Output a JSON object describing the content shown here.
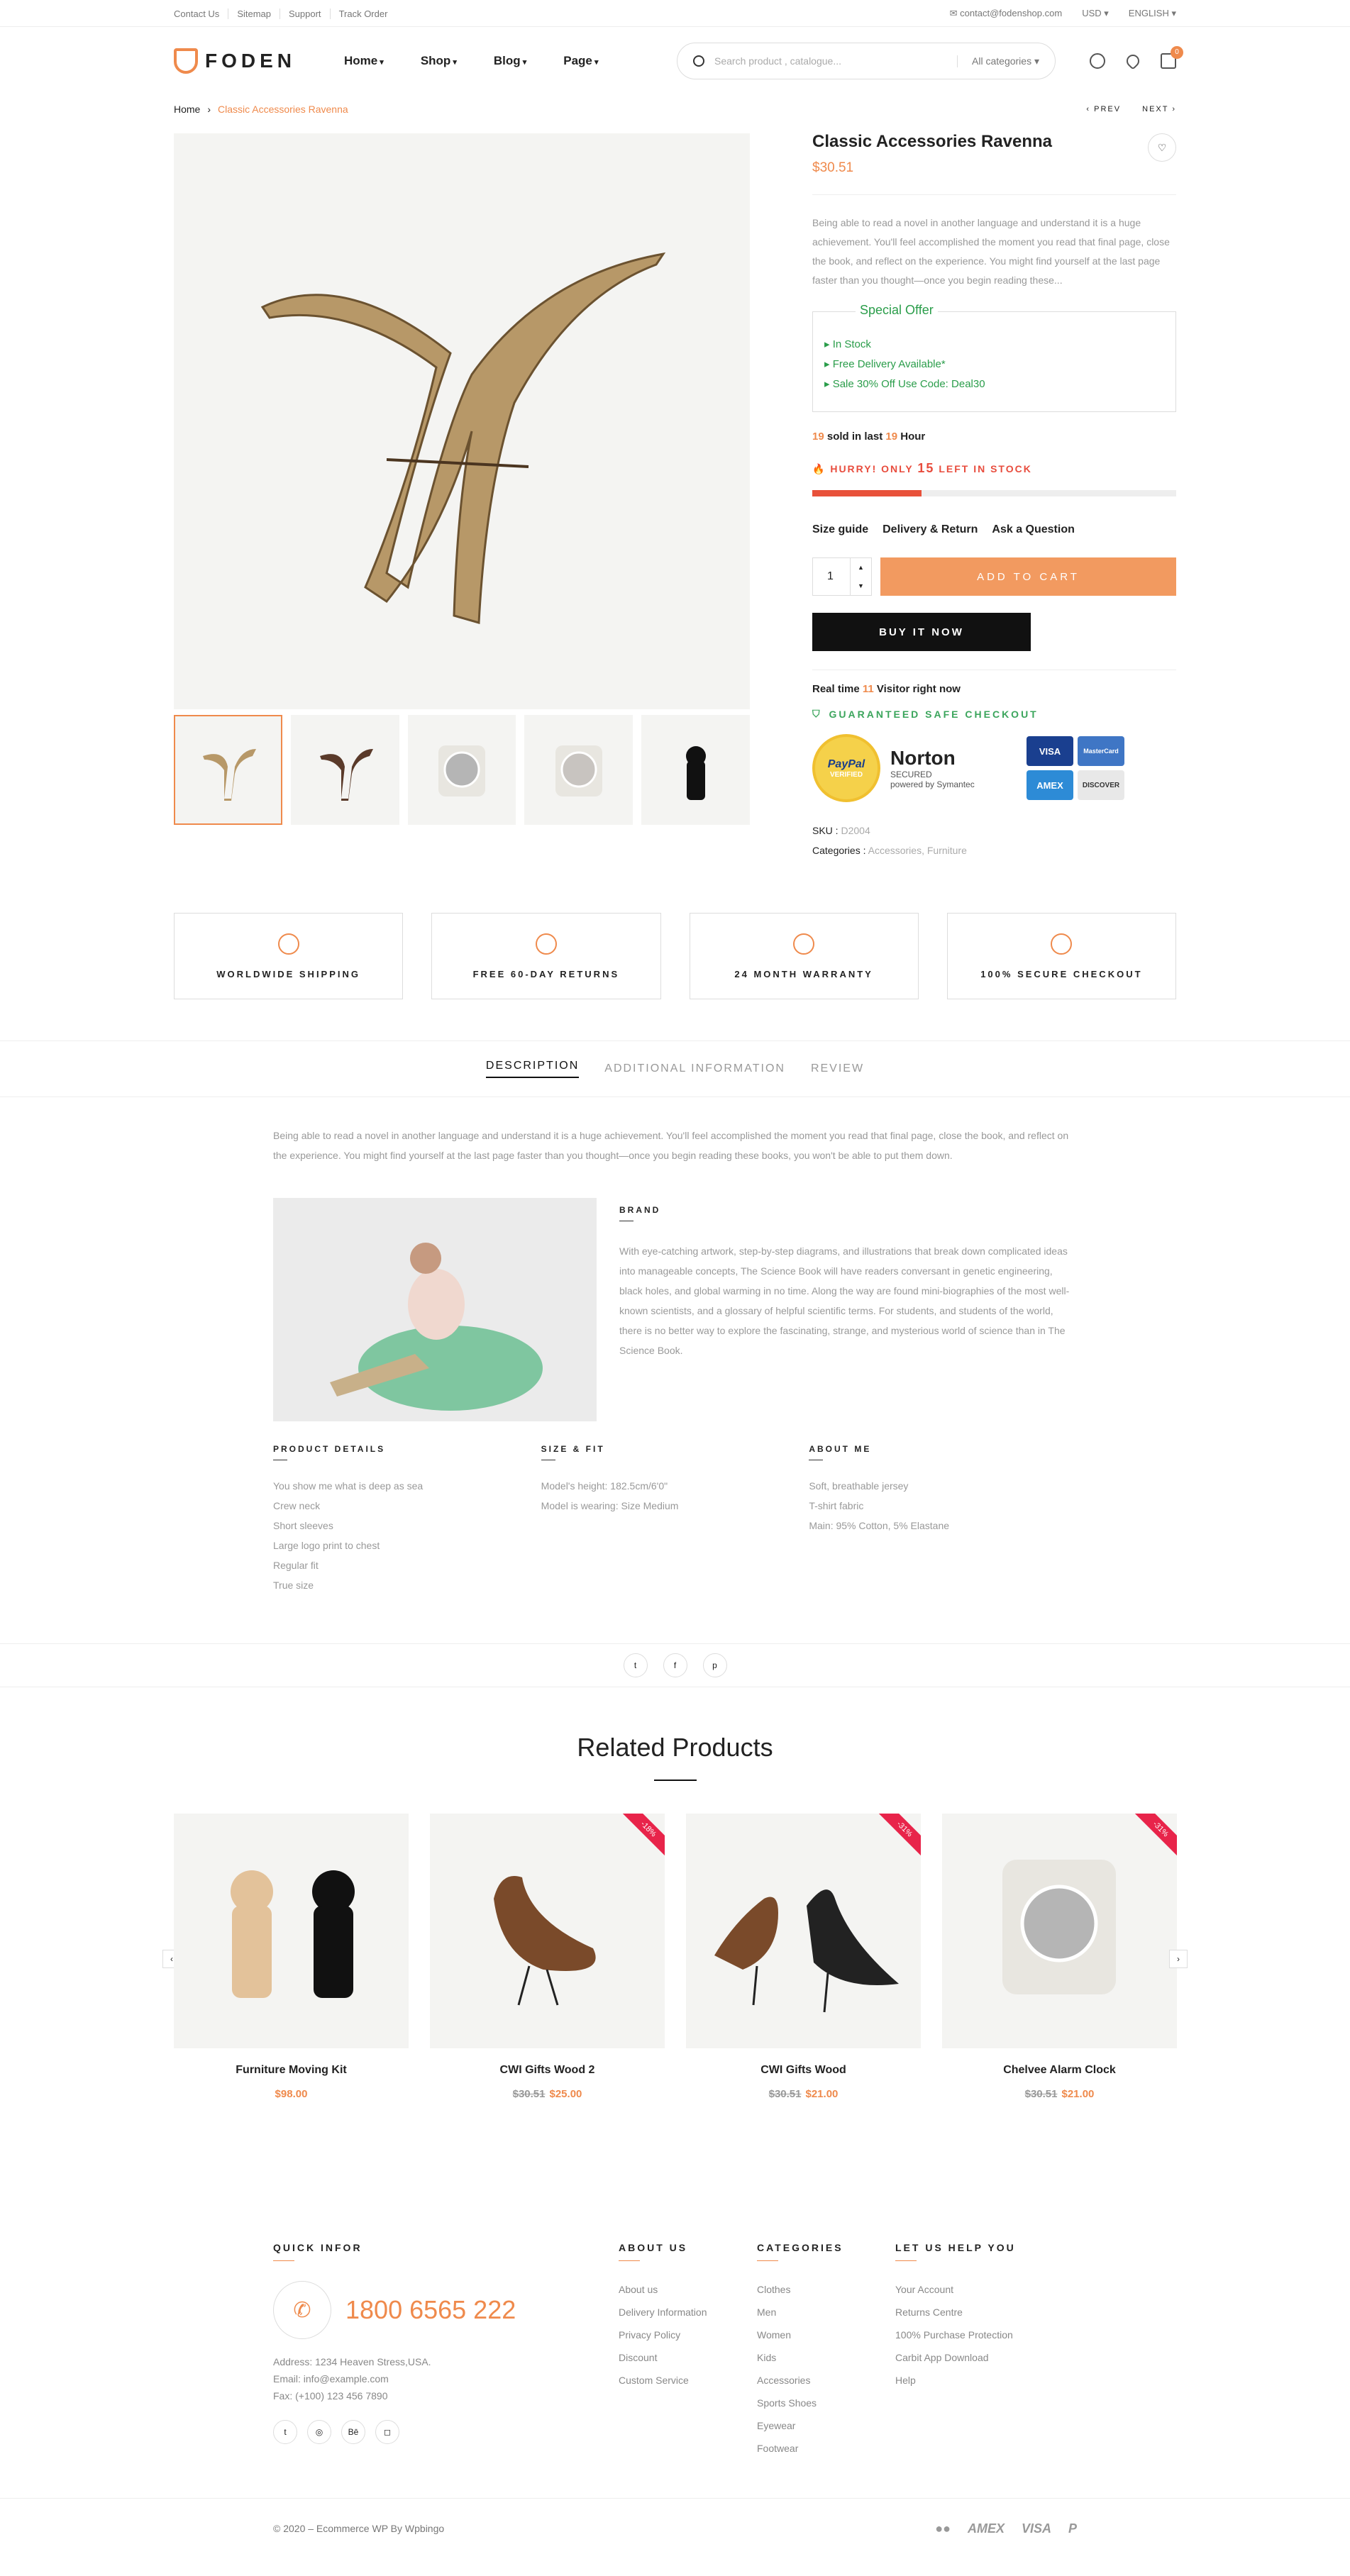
{
  "topbar": {
    "links": [
      "Contact Us",
      "Sitemap",
      "Support",
      "Track Order"
    ],
    "email": "contact@fodenshop.com",
    "currency": "USD",
    "language": "ENGLISH"
  },
  "header": {
    "logo": "FODEN",
    "nav": [
      "Home",
      "Shop",
      "Blog",
      "Page"
    ],
    "search_placeholder": "Search product , catalogue...",
    "category": "All categories",
    "cart_count": "0"
  },
  "breadcrumb": {
    "home": "Home",
    "current": "Classic Accessories Ravenna",
    "prev": "PREV",
    "next": "NEXT"
  },
  "product": {
    "title": "Classic Accessories Ravenna",
    "price": "$30.51",
    "description": "Being able to read a novel in another language and understand it is a huge achievement. You'll feel accomplished the moment you read that final page, close the book, and reflect on the experience. You might find yourself at the last page faster than you thought—once you begin reading these...",
    "offer_title": "Special Offer",
    "offers": [
      "In Stock",
      "Free Delivery Available*",
      "Sale 30% Off Use Code: Deal30"
    ],
    "sold_count": "19",
    "sold_mid": "sold in last",
    "sold_hours": "19",
    "sold_unit": "Hour",
    "hurry_prefix": "HURRY! ONLY",
    "hurry_count": "15",
    "hurry_suffix": "LEFT IN STOCK",
    "stock_progress": 0.3,
    "links": [
      "Size guide",
      "Delivery & Return",
      "Ask a Question"
    ],
    "qty": "1",
    "add_to_cart": "ADD TO CART",
    "buy_now": "BUY IT NOW",
    "realtime_prefix": "Real time",
    "realtime_count": "11",
    "realtime_suffix": "Visitor right now",
    "safe_checkout": "GUARANTEED SAFE CHECKOUT",
    "badges": {
      "paypal_top": "PayPal",
      "paypal_bottom": "VERIFIED",
      "norton": "Norton",
      "norton_sub": "SECURED",
      "norton_powered": "powered by Symantec",
      "cards": [
        "VISA",
        "MasterCard",
        "AMEX",
        "DISCOVER"
      ]
    },
    "sku_label": "SKU :",
    "sku": "D2004",
    "categories_label": "Categories :",
    "categories": "Accessories, Furniture"
  },
  "features": [
    "WORLDWIDE SHIPPING",
    "FREE 60-DAY RETURNS",
    "24 MONTH WARRANTY",
    "100% SECURE CHECKOUT"
  ],
  "tabs": [
    "DESCRIPTION",
    "ADDITIONAL INFORMATION",
    "REVIEW"
  ],
  "description": {
    "lead": "Being able to read a novel in another language and understand it is a huge achievement. You'll feel accomplished the moment you read that final page, close the book, and reflect on the experience. You might find yourself at the last page faster than you thought—once you begin reading these books, you won't be able to put them down.",
    "brand_title": "BRAND",
    "brand_text": "With eye-catching artwork, step-by-step diagrams, and illustrations that break down complicated ideas into manageable concepts, The Science Book will have readers conversant in genetic engineering, black holes, and global warming in no time. Along the way are found mini-biographies of the most well-known scientists, and a glossary of helpful scientific terms. For students, and students of the world, there is no better way to explore the fascinating, strange, and mysterious world of science than in The Science Book.",
    "cols": [
      {
        "title": "PRODUCT DETAILS",
        "items": [
          "You show me what is deep as sea",
          "Crew neck",
          "Short sleeves",
          "Large logo print to chest",
          "Regular fit",
          "True size"
        ]
      },
      {
        "title": "SIZE & FIT",
        "items": [
          "Model's height: 182.5cm/6'0\"",
          "Model is wearing: Size Medium"
        ]
      },
      {
        "title": "ABOUT ME",
        "items": [
          "Soft, breathable jersey",
          "T-shirt fabric",
          "Main: 95% Cotton, 5% Elastane"
        ]
      }
    ]
  },
  "related": {
    "title": "Related Products",
    "items": [
      {
        "name": "Furniture Moving Kit",
        "old": "",
        "price": "$98.00",
        "ribbon": ""
      },
      {
        "name": "CWI Gifts Wood 2",
        "old": "$30.51",
        "price": "$25.00",
        "ribbon": "-18%"
      },
      {
        "name": "CWI Gifts Wood",
        "old": "$30.51",
        "price": "$21.00",
        "ribbon": "-31%"
      },
      {
        "name": "Chelvee Alarm Clock",
        "old": "$30.51",
        "price": "$21.00",
        "ribbon": "-31%"
      }
    ]
  },
  "footer": {
    "quick": {
      "title": "QUICK INFOR",
      "phone": "1800 6565 222",
      "address": "Address: 1234 Heaven Stress,USA.",
      "email": "Email: info@example.com",
      "fax": "Fax: (+100) 123 456 7890"
    },
    "about": {
      "title": "ABOUT US",
      "items": [
        "About us",
        "Delivery Information",
        "Privacy Policy",
        "Discount",
        "Custom Service"
      ]
    },
    "categories": {
      "title": "CATEGORIES",
      "items": [
        "Clothes",
        "Men",
        "Women",
        "Kids",
        "Accessories",
        "Sports Shoes",
        "Eyewear",
        "Footwear"
      ]
    },
    "help": {
      "title": "LET US HELP YOU",
      "items": [
        "Your Account",
        "Returns Centre",
        "100% Purchase Protection",
        "Carbit App Download",
        "Help"
      ]
    },
    "copyright": "© 2020 – Ecommerce WP By Wpbingo",
    "payments": [
      "AMEX",
      "VISA",
      "P"
    ]
  },
  "colors": {
    "accent": "#ef8a4c",
    "green": "#2a9d4a",
    "red": "#e8513a"
  }
}
